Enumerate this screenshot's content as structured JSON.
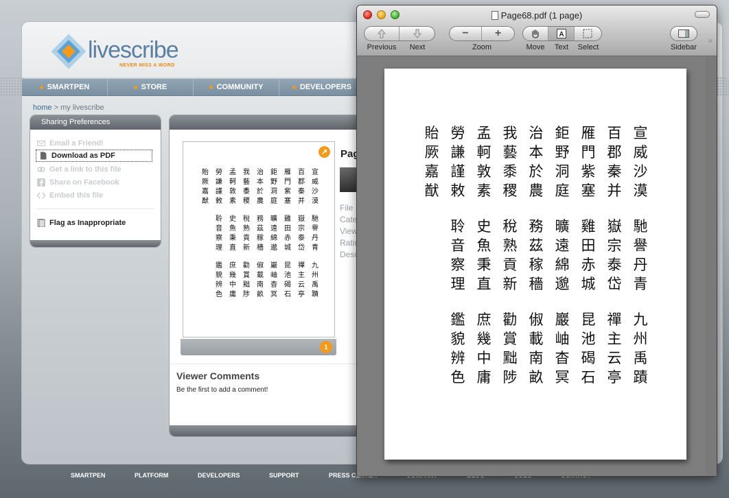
{
  "site": {
    "logo_text": "livescribe",
    "logo_tagline": "NEVER MISS A WORD",
    "nav": [
      "SMARTPEN",
      "STORE",
      "COMMUNITY",
      "DEVELOPERS"
    ],
    "breadcrumb": {
      "home": "home",
      "sep": ">",
      "current": "my livescribe"
    },
    "sharing": {
      "title": "Sharing Preferences",
      "items": [
        {
          "label": "Email a Friend!",
          "icon": "mail-icon"
        },
        {
          "label": "Download as PDF",
          "icon": "document-icon"
        },
        {
          "label": "Get a link to this file",
          "icon": "link-icon"
        },
        {
          "label": "Share on Facebook",
          "icon": "facebook-icon"
        },
        {
          "label": "Embed this file",
          "icon": "code-icon"
        },
        {
          "label": "Flag as Inappropriate",
          "icon": "flag-icon"
        }
      ]
    },
    "document": {
      "title": "Pag",
      "meta": [
        "File",
        "Cate",
        "View",
        "Ratin",
        "Desc"
      ],
      "page_count_badge": "1",
      "expand_icon": "expand-arrow-icon"
    },
    "comments": {
      "title": "Viewer Comments",
      "empty_text": "Be the first to add a comment!"
    },
    "footer_nav": [
      "SMARTPEN",
      "PLATFORM",
      "DEVELOPERS",
      "SUPPORT",
      "PRESS CENTER",
      "COMPANY",
      "BLOG",
      "JOBS",
      "CONTACT"
    ]
  },
  "preview": {
    "window_title": "Page68.pdf (1 page)",
    "toolbar": {
      "previous_label": "Previous",
      "next_label": "Next",
      "zoom_label": "Zoom",
      "move_label": "Move",
      "text_label": "Text",
      "select_label": "Select",
      "sidebar_label": "Sidebar"
    }
  },
  "handwriting": {
    "block1": [
      "宣威沙漠",
      "百郡秦并",
      "雁門紫塞",
      "鉅野洞庭",
      "治本於農",
      "我藝黍稷",
      "孟軻敦素",
      "勞謙謹敕",
      "貽厥嘉猷"
    ],
    "block2": [
      "馳譽丹青",
      "嶽宗泰岱",
      "雞田赤城",
      "曠遠綿邈",
      "務茲稼穡",
      "稅熟貢新",
      "史魚秉直",
      "聆音察理"
    ],
    "block3": [
      "九州禹蹟",
      "禪主云亭",
      "昆池碣石",
      "巖岫杳冥",
      "俶載南畝",
      "勸賞黜陟",
      "庶幾中庸",
      "鑑貌辨色"
    ]
  },
  "colors": {
    "accent": "#f29a1c",
    "nav_blue": "#7990a1",
    "link": "#3b6a93"
  }
}
